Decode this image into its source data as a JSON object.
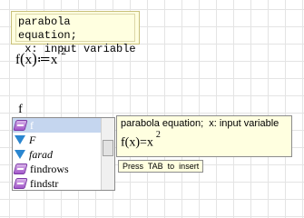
{
  "comment": {
    "line1": "parabola equation;",
    "line2": " x: input variable"
  },
  "definition": {
    "name": "f",
    "open": "(",
    "arg": "x",
    "close": ")",
    "assign": "≔",
    "body": "x",
    "exponent": "2"
  },
  "typed_text": "f",
  "autocomplete": {
    "items": [
      {
        "label": "f",
        "icon": "function-icon",
        "italic": false,
        "selected": true
      },
      {
        "label": "F",
        "icon": "unit-icon",
        "italic": true,
        "selected": false
      },
      {
        "label": "farad",
        "icon": "unit-icon",
        "italic": true,
        "selected": false
      },
      {
        "label": "findrows",
        "icon": "function-icon",
        "italic": false,
        "selected": false
      },
      {
        "label": "findstr",
        "icon": "function-icon",
        "italic": false,
        "selected": false
      }
    ]
  },
  "tooltip": {
    "description": "parabola equation;  x: input variable",
    "formula_name": "f",
    "formula_open": "(",
    "formula_arg": "x",
    "formula_close": ")",
    "formula_eq": "=",
    "formula_body": "x",
    "formula_exponent": "2"
  },
  "hint": "Press  TAB  to  insert"
}
